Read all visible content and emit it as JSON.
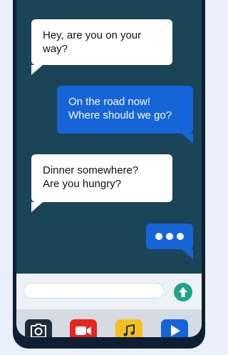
{
  "messages": [
    {
      "direction": "incoming",
      "text_lines": [
        "Hey, are you on your",
        "way?"
      ]
    },
    {
      "direction": "outgoing",
      "text_lines": [
        "On the road now!",
        "Where should we go?"
      ]
    },
    {
      "direction": "incoming",
      "text_lines": [
        "Dinner somewhere?",
        "Are you hungry?"
      ]
    },
    {
      "direction": "outgoing",
      "typing_indicator": true
    }
  ],
  "input": {
    "value": "",
    "placeholder": ""
  },
  "send_button": {
    "icon": "arrow-up-icon",
    "color": "#20a38a"
  },
  "app_buttons": [
    {
      "icon": "camera-icon",
      "color": "#1f2b3a"
    },
    {
      "icon": "video-camera-icon",
      "color": "#e8241b"
    },
    {
      "icon": "music-note-icon",
      "color": "#f4c01e"
    },
    {
      "icon": "play-icon",
      "color": "#1565d8"
    }
  ],
  "colors": {
    "incoming_bubble": "#ffffff",
    "outgoing_bubble": "#1565d8",
    "chat_background": "#1a4458",
    "phone_frame": "#0f1f33"
  }
}
